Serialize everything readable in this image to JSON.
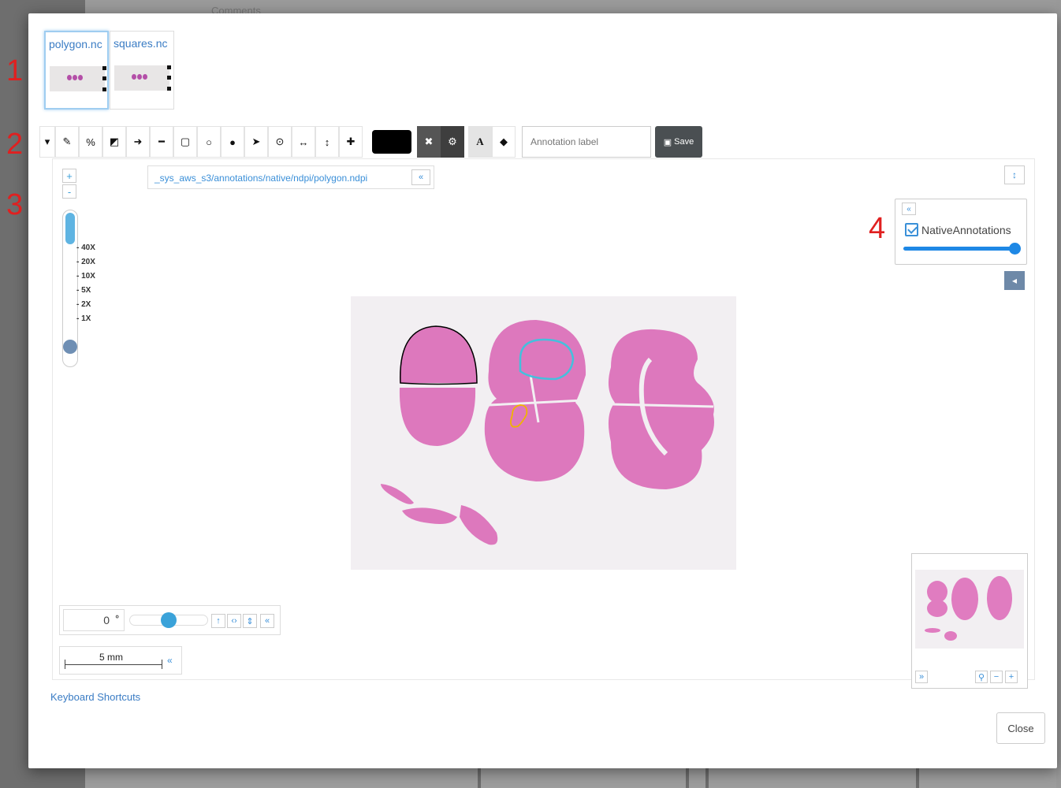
{
  "background": {
    "tab_label": "Comments"
  },
  "callouts": [
    "1",
    "2",
    "3",
    "4"
  ],
  "thumbnails": [
    {
      "label": "polygon.nc",
      "selected": true
    },
    {
      "label": "squares.nc",
      "selected": false
    }
  ],
  "toolbar": {
    "tools": [
      "dropdown-caret-icon",
      "pencil-icon",
      "freehand-icon",
      "polygon-icon",
      "arrow-icon",
      "line-icon",
      "rectangle-icon",
      "circle-icon",
      "point-icon",
      "pointer-icon",
      "target-icon",
      "horizontal-measure-icon",
      "vertical-measure-icon",
      "crosshair-icon"
    ],
    "color_value": "#000000",
    "annotation_label_placeholder": "Annotation label",
    "save_label": "Save"
  },
  "viewer": {
    "zoom_in": "+",
    "zoom_out": "-",
    "zoom_levels": [
      "40X",
      "20X",
      "10X",
      "5X",
      "2X",
      "1X"
    ],
    "zoom_level_fraction": 0.0,
    "file_path": "_sys_aws_s3/annotations/native/ndpi/polygon.ndpi",
    "collapse_label": "«",
    "layers": {
      "collapse_label": "«",
      "layer_name": "NativeAnnotations",
      "checked": true,
      "opacity_fraction": 1.0
    },
    "rotation": {
      "value": "0",
      "unit": "°",
      "collapse_label": "«"
    },
    "scale_bar": {
      "label": "5 mm",
      "collapse_label": "«"
    },
    "navigator": {
      "expand_label": "»",
      "zoom_in": "+",
      "zoom_out": "−"
    },
    "accent_color": "#3a9fd8",
    "annotation_colors": {
      "outline1": "#000000",
      "outline2": "#44c0dd",
      "outline3": "#f0b400"
    }
  },
  "footer": {
    "keyboard_shortcuts": "Keyboard Shortcuts",
    "close_label": "Close"
  }
}
